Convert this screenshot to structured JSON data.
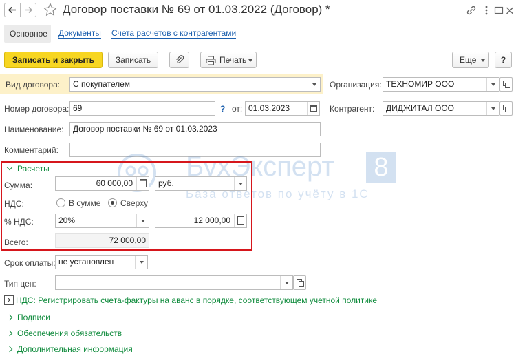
{
  "window": {
    "title": "Договор поставки № 69 от 01.03.2022 (Договор) *"
  },
  "tabs": [
    {
      "label": "Основное"
    },
    {
      "label": "Документы"
    },
    {
      "label": "Счета расчетов с контрагентами"
    }
  ],
  "toolbar": {
    "save_close": "Записать и закрыть",
    "save": "Записать",
    "print": "Печать",
    "more": "Еще",
    "help": "?"
  },
  "form": {
    "kind_label": "Вид договора:",
    "kind_value": "С покупателем",
    "org_label": "Организация:",
    "org_value": "ТЕХНОМИР ООО",
    "number_label": "Номер договора:",
    "number_value": "69",
    "number_help": "?",
    "date_label": "от:",
    "date_value": "01.03.2023",
    "counterparty_label": "Контрагент:",
    "counterparty_value": "ДИДЖИТАЛ ООО",
    "name_label": "Наименование:",
    "name_value": "Договор поставки № 69 от 01.03.2023",
    "comment_label": "Комментарий:",
    "comment_value": ""
  },
  "settlements": {
    "title": "Расчеты",
    "sum_label": "Сумма:",
    "sum_value": "60 000,00",
    "currency": "руб.",
    "vat_label": "НДС:",
    "vat_in_sum": "В сумме",
    "vat_on_top": "Сверху",
    "vat_on_top_selected": true,
    "vat_rate_label": "% НДС:",
    "vat_rate_value": "20%",
    "vat_amount": "12 000,00",
    "total_label": "Всего:",
    "total_value": "72 000,00"
  },
  "payment": {
    "term_label": "Срок оплаты:",
    "term_value": "не установлен",
    "price_type_label": "Тип цен:",
    "price_type_value": ""
  },
  "links": {
    "vat_invoices": "НДС: Регистрировать счета-фактуры на аванс в порядке, соответствующем учетной политике",
    "signatures": "Подписи",
    "obligations": "Обеспечения обязательств",
    "additional": "Дополнительная информация"
  },
  "watermark": {
    "brand": "БухЭксперт",
    "badge": "8",
    "tagline": "База ответов по учёту в 1С"
  },
  "colors": {
    "primary_button": "#f7d622",
    "highlight_row": "#fdf1c9",
    "link": "#1b5fae",
    "accent_green": "#0f8b3c",
    "callout_border": "#d6161c"
  }
}
